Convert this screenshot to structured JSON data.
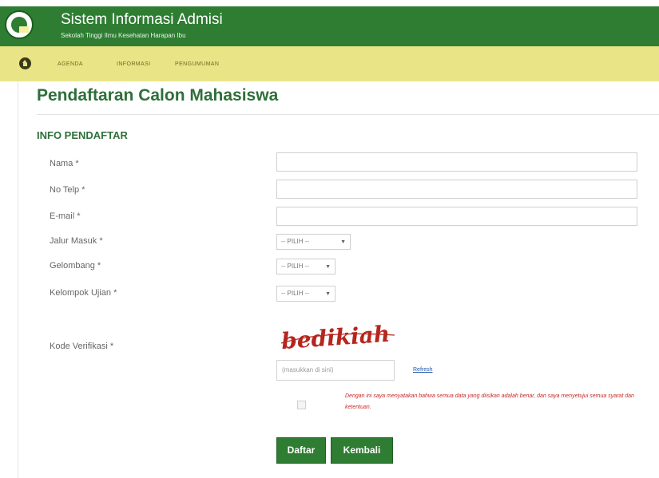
{
  "header": {
    "title": "Sistem Informasi Admisi",
    "subtitle": "Sekolah Tinggi Ilmu Kesehatan Harapan Ibu"
  },
  "nav": {
    "items": [
      "AGENDA",
      "INFORMASI",
      "PENGUMUMAN"
    ]
  },
  "page": {
    "title": "Pendaftaran Calon Mahasiswa",
    "section": "INFO PENDAFTAR"
  },
  "form": {
    "nama_label": "Nama *",
    "telp_label": "No Telp *",
    "email_label": "E-mail *",
    "jalur_label": "Jalur Masuk *",
    "gelombang_label": "Gelombang *",
    "kelompok_label": "Kelompok Ujian *",
    "kode_label": "Kode Verifikasi *",
    "select_value": "-- PILIH --",
    "captcha_text": "bedikiah",
    "captcha_placeholder": "(masukkan di sini)",
    "refresh_label": "Refresh",
    "agree_text": "Dengan ini saya menyatakan bahwa semua data yang diisikan adalah benar, dan saya menyetujui semua syarat dan ketentuan.",
    "submit_label": "Daftar",
    "back_label": "Kembali"
  },
  "colors": {
    "header_green": "#2e7d32",
    "nav_yellow": "#e9e586",
    "title_green": "#2f6f3a",
    "agree_red": "#c62828"
  }
}
